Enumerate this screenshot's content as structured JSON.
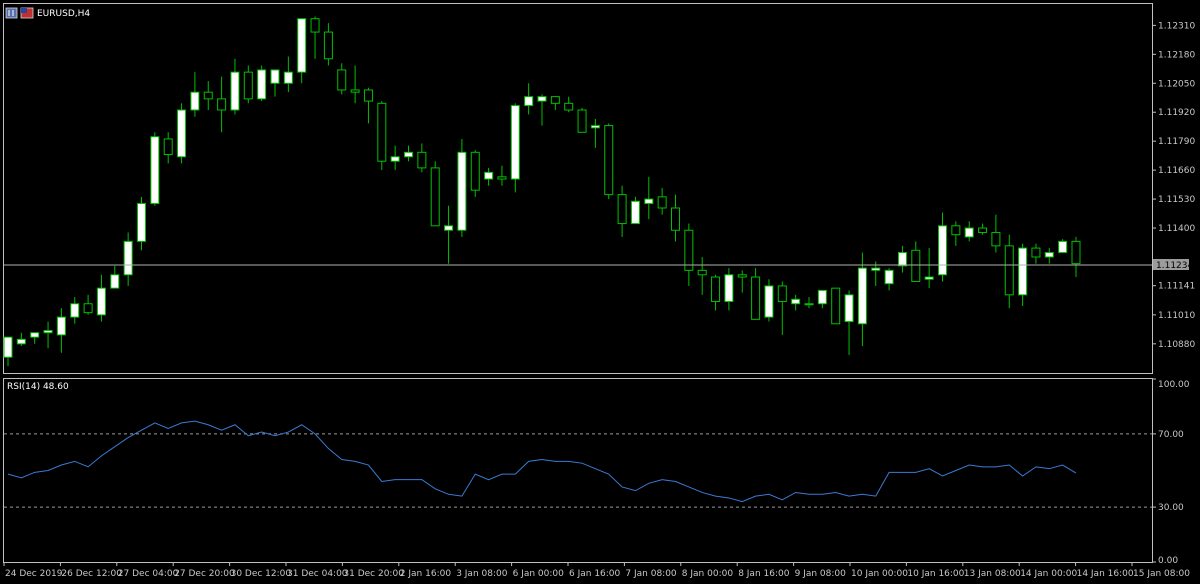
{
  "window": {
    "symbol_title": "EURUSD,H4",
    "current_price_label": "1.11234"
  },
  "colors": {
    "background": "#000000",
    "frame": "#c0c0c0",
    "bull_body": "#ffffff",
    "bear_body": "#000000",
    "wick": "#00c000",
    "rsi_line": "#3a7bd5",
    "bid_line": "#b0b0b0",
    "level_line": "#9a9a9a",
    "text": "#c8c8c8"
  },
  "chart_data": [
    {
      "type": "candlestick",
      "title": "EURUSD,H4",
      "ylim": [
        1.10749,
        1.12406
      ],
      "y_ticks": [
        "1.12310",
        "1.12180",
        "1.12050",
        "1.11920",
        "1.11790",
        "1.11660",
        "1.11530",
        "1.11400",
        "1.11141",
        "1.11010",
        "1.10880"
      ],
      "current_price": 1.11234,
      "x_tick_labels": [
        "24 Dec 2019",
        "26 Dec 12:00",
        "27 Dec 04:00",
        "27 Dec 20:00",
        "30 Dec 12:00",
        "31 Dec 04:00",
        "31 Dec 20:00",
        "2 Jan 16:00",
        "3 Jan 08:00",
        "6 Jan 00:00",
        "6 Jan 16:00",
        "7 Jan 08:00",
        "8 Jan 00:00",
        "8 Jan 16:00",
        "9 Jan 08:00",
        "10 Jan 00:00",
        "10 Jan 16:00",
        "13 Jan 08:00",
        "14 Jan 00:00",
        "14 Jan 16:00",
        "15 Jan 08:00"
      ],
      "candles": [
        {
          "o": 1.1082,
          "h": 1.1091,
          "l": 1.1078,
          "c": 1.1091
        },
        {
          "o": 1.1088,
          "h": 1.1093,
          "l": 1.1087,
          "c": 1.109
        },
        {
          "o": 1.1091,
          "h": 1.1093,
          "l": 1.1088,
          "c": 1.1093
        },
        {
          "o": 1.1093,
          "h": 1.1098,
          "l": 1.1086,
          "c": 1.1094
        },
        {
          "o": 1.1092,
          "h": 1.1104,
          "l": 1.1084,
          "c": 1.11
        },
        {
          "o": 1.11,
          "h": 1.1109,
          "l": 1.1097,
          "c": 1.1106
        },
        {
          "o": 1.1106,
          "h": 1.111,
          "l": 1.1101,
          "c": 1.1102
        },
        {
          "o": 1.1101,
          "h": 1.1119,
          "l": 1.1098,
          "c": 1.1113
        },
        {
          "o": 1.1113,
          "h": 1.1123,
          "l": 1.1113,
          "c": 1.1119
        },
        {
          "o": 1.1119,
          "h": 1.1138,
          "l": 1.1114,
          "c": 1.1134
        },
        {
          "o": 1.1134,
          "h": 1.1154,
          "l": 1.113,
          "c": 1.1151
        },
        {
          "o": 1.1151,
          "h": 1.1183,
          "l": 1.115,
          "c": 1.1181
        },
        {
          "o": 1.118,
          "h": 1.1183,
          "l": 1.1169,
          "c": 1.1173
        },
        {
          "o": 1.1172,
          "h": 1.1196,
          "l": 1.1169,
          "c": 1.1193
        },
        {
          "o": 1.1193,
          "h": 1.121,
          "l": 1.119,
          "c": 1.1201
        },
        {
          "o": 1.1201,
          "h": 1.1206,
          "l": 1.1193,
          "c": 1.1198
        },
        {
          "o": 1.1198,
          "h": 1.1208,
          "l": 1.1183,
          "c": 1.1193
        },
        {
          "o": 1.1193,
          "h": 1.1216,
          "l": 1.1191,
          "c": 1.121
        },
        {
          "o": 1.121,
          "h": 1.1213,
          "l": 1.1196,
          "c": 1.1198
        },
        {
          "o": 1.1198,
          "h": 1.1213,
          "l": 1.1197,
          "c": 1.1211
        },
        {
          "o": 1.1205,
          "h": 1.1211,
          "l": 1.1199,
          "c": 1.1211
        },
        {
          "o": 1.1205,
          "h": 1.1217,
          "l": 1.1201,
          "c": 1.121
        },
        {
          "o": 1.121,
          "h": 1.1234,
          "l": 1.1205,
          "c": 1.1234
        },
        {
          "o": 1.1234,
          "h": 1.1235,
          "l": 1.1216,
          "c": 1.1228
        },
        {
          "o": 1.1228,
          "h": 1.1232,
          "l": 1.1213,
          "c": 1.1216
        },
        {
          "o": 1.1211,
          "h": 1.1214,
          "l": 1.12,
          "c": 1.1202
        },
        {
          "o": 1.1202,
          "h": 1.1213,
          "l": 1.1196,
          "c": 1.1201
        },
        {
          "o": 1.1202,
          "h": 1.1203,
          "l": 1.1187,
          "c": 1.1197
        },
        {
          "o": 1.1196,
          "h": 1.1197,
          "l": 1.1166,
          "c": 1.117
        },
        {
          "o": 1.117,
          "h": 1.1177,
          "l": 1.1166,
          "c": 1.1172
        },
        {
          "o": 1.1172,
          "h": 1.1177,
          "l": 1.117,
          "c": 1.1174
        },
        {
          "o": 1.1174,
          "h": 1.1178,
          "l": 1.1165,
          "c": 1.1167
        },
        {
          "o": 1.1167,
          "h": 1.117,
          "l": 1.1141,
          "c": 1.1141
        },
        {
          "o": 1.1139,
          "h": 1.115,
          "l": 1.1124,
          "c": 1.1141
        },
        {
          "o": 1.1139,
          "h": 1.118,
          "l": 1.1136,
          "c": 1.1174
        },
        {
          "o": 1.1174,
          "h": 1.1175,
          "l": 1.1154,
          "c": 1.1157
        },
        {
          "o": 1.1162,
          "h": 1.1167,
          "l": 1.1159,
          "c": 1.1165
        },
        {
          "o": 1.1163,
          "h": 1.1168,
          "l": 1.1159,
          "c": 1.1162
        },
        {
          "o": 1.1162,
          "h": 1.1196,
          "l": 1.1156,
          "c": 1.1195
        },
        {
          "o": 1.1195,
          "h": 1.1205,
          "l": 1.1191,
          "c": 1.1199
        },
        {
          "o": 1.1197,
          "h": 1.12,
          "l": 1.1186,
          "c": 1.1199
        },
        {
          "o": 1.1199,
          "h": 1.1199,
          "l": 1.1193,
          "c": 1.1196
        },
        {
          "o": 1.1196,
          "h": 1.1199,
          "l": 1.1192,
          "c": 1.1193
        },
        {
          "o": 1.1193,
          "h": 1.1194,
          "l": 1.1183,
          "c": 1.1183
        },
        {
          "o": 1.1185,
          "h": 1.1189,
          "l": 1.1176,
          "c": 1.1186
        },
        {
          "o": 1.1186,
          "h": 1.1187,
          "l": 1.1153,
          "c": 1.1155
        },
        {
          "o": 1.1155,
          "h": 1.1159,
          "l": 1.1136,
          "c": 1.1142
        },
        {
          "o": 1.1142,
          "h": 1.1154,
          "l": 1.1142,
          "c": 1.1152
        },
        {
          "o": 1.1151,
          "h": 1.1163,
          "l": 1.1144,
          "c": 1.1153
        },
        {
          "o": 1.1154,
          "h": 1.1158,
          "l": 1.1146,
          "c": 1.1149
        },
        {
          "o": 1.1149,
          "h": 1.1155,
          "l": 1.1134,
          "c": 1.1139
        },
        {
          "o": 1.1139,
          "h": 1.1142,
          "l": 1.1114,
          "c": 1.1121
        },
        {
          "o": 1.1121,
          "h": 1.1127,
          "l": 1.111,
          "c": 1.1119
        },
        {
          "o": 1.1118,
          "h": 1.1119,
          "l": 1.1103,
          "c": 1.1107
        },
        {
          "o": 1.1107,
          "h": 1.1122,
          "l": 1.1103,
          "c": 1.1119
        },
        {
          "o": 1.1119,
          "h": 1.1121,
          "l": 1.1111,
          "c": 1.1118
        },
        {
          "o": 1.1118,
          "h": 1.1122,
          "l": 1.1099,
          "c": 1.1099
        },
        {
          "o": 1.11,
          "h": 1.1117,
          "l": 1.1098,
          "c": 1.1114
        },
        {
          "o": 1.1114,
          "h": 1.1116,
          "l": 1.1092,
          "c": 1.1107
        },
        {
          "o": 1.1106,
          "h": 1.111,
          "l": 1.1103,
          "c": 1.1108
        },
        {
          "o": 1.1106,
          "h": 1.1109,
          "l": 1.1104,
          "c": 1.1106
        },
        {
          "o": 1.1106,
          "h": 1.1112,
          "l": 1.1104,
          "c": 1.1112
        },
        {
          "o": 1.1113,
          "h": 1.1113,
          "l": 1.1097,
          "c": 1.1097
        },
        {
          "o": 1.1098,
          "h": 1.1112,
          "l": 1.1083,
          "c": 1.111
        },
        {
          "o": 1.1097,
          "h": 1.1129,
          "l": 1.1087,
          "c": 1.1122
        },
        {
          "o": 1.1121,
          "h": 1.1125,
          "l": 1.1114,
          "c": 1.1122
        },
        {
          "o": 1.1115,
          "h": 1.1122,
          "l": 1.1112,
          "c": 1.1121
        },
        {
          "o": 1.1123,
          "h": 1.1132,
          "l": 1.112,
          "c": 1.1129
        },
        {
          "o": 1.113,
          "h": 1.1134,
          "l": 1.1116,
          "c": 1.1116
        },
        {
          "o": 1.1117,
          "h": 1.1131,
          "l": 1.1113,
          "c": 1.1118
        },
        {
          "o": 1.1119,
          "h": 1.1147,
          "l": 1.1116,
          "c": 1.1141
        },
        {
          "o": 1.1141,
          "h": 1.1143,
          "l": 1.1132,
          "c": 1.1137
        },
        {
          "o": 1.1136,
          "h": 1.1143,
          "l": 1.1134,
          "c": 1.114
        },
        {
          "o": 1.114,
          "h": 1.1142,
          "l": 1.1137,
          "c": 1.1138
        },
        {
          "o": 1.1138,
          "h": 1.1146,
          "l": 1.1129,
          "c": 1.1132
        },
        {
          "o": 1.1132,
          "h": 1.1137,
          "l": 1.1104,
          "c": 1.111
        },
        {
          "o": 1.111,
          "h": 1.1133,
          "l": 1.1105,
          "c": 1.1131
        },
        {
          "o": 1.1131,
          "h": 1.1133,
          "l": 1.1124,
          "c": 1.1127
        },
        {
          "o": 1.1127,
          "h": 1.1131,
          "l": 1.1124,
          "c": 1.1129
        },
        {
          "o": 1.1129,
          "h": 1.1135,
          "l": 1.1129,
          "c": 1.1134
        },
        {
          "o": 1.1134,
          "h": 1.1136,
          "l": 1.1118,
          "c": 1.1124
        }
      ]
    },
    {
      "type": "line",
      "title": "RSI(14) 48.60",
      "ylim": [
        0,
        100
      ],
      "y_ticks": [
        "100.00",
        "70.00",
        "30.00",
        "0.00"
      ],
      "levels": [
        70,
        30
      ],
      "series": [
        {
          "name": "RSI(14)",
          "values": [
            48,
            46,
            49,
            50,
            53,
            55,
            52,
            58,
            63,
            68,
            72,
            76,
            73,
            76,
            77,
            75,
            72,
            75,
            69,
            71,
            69,
            71,
            75,
            70,
            62,
            56,
            55,
            53,
            44,
            45,
            45,
            45,
            40,
            37,
            36,
            48,
            45,
            48,
            48,
            55,
            56,
            55,
            55,
            54,
            51,
            48,
            41,
            39,
            43,
            45,
            44,
            41,
            38,
            36,
            35,
            33,
            36,
            37,
            34,
            38,
            37,
            37,
            38,
            36,
            37,
            36,
            49,
            49,
            49,
            51,
            47,
            50,
            53,
            52,
            52,
            53,
            47,
            52,
            51,
            53,
            48.6
          ]
        }
      ]
    }
  ]
}
